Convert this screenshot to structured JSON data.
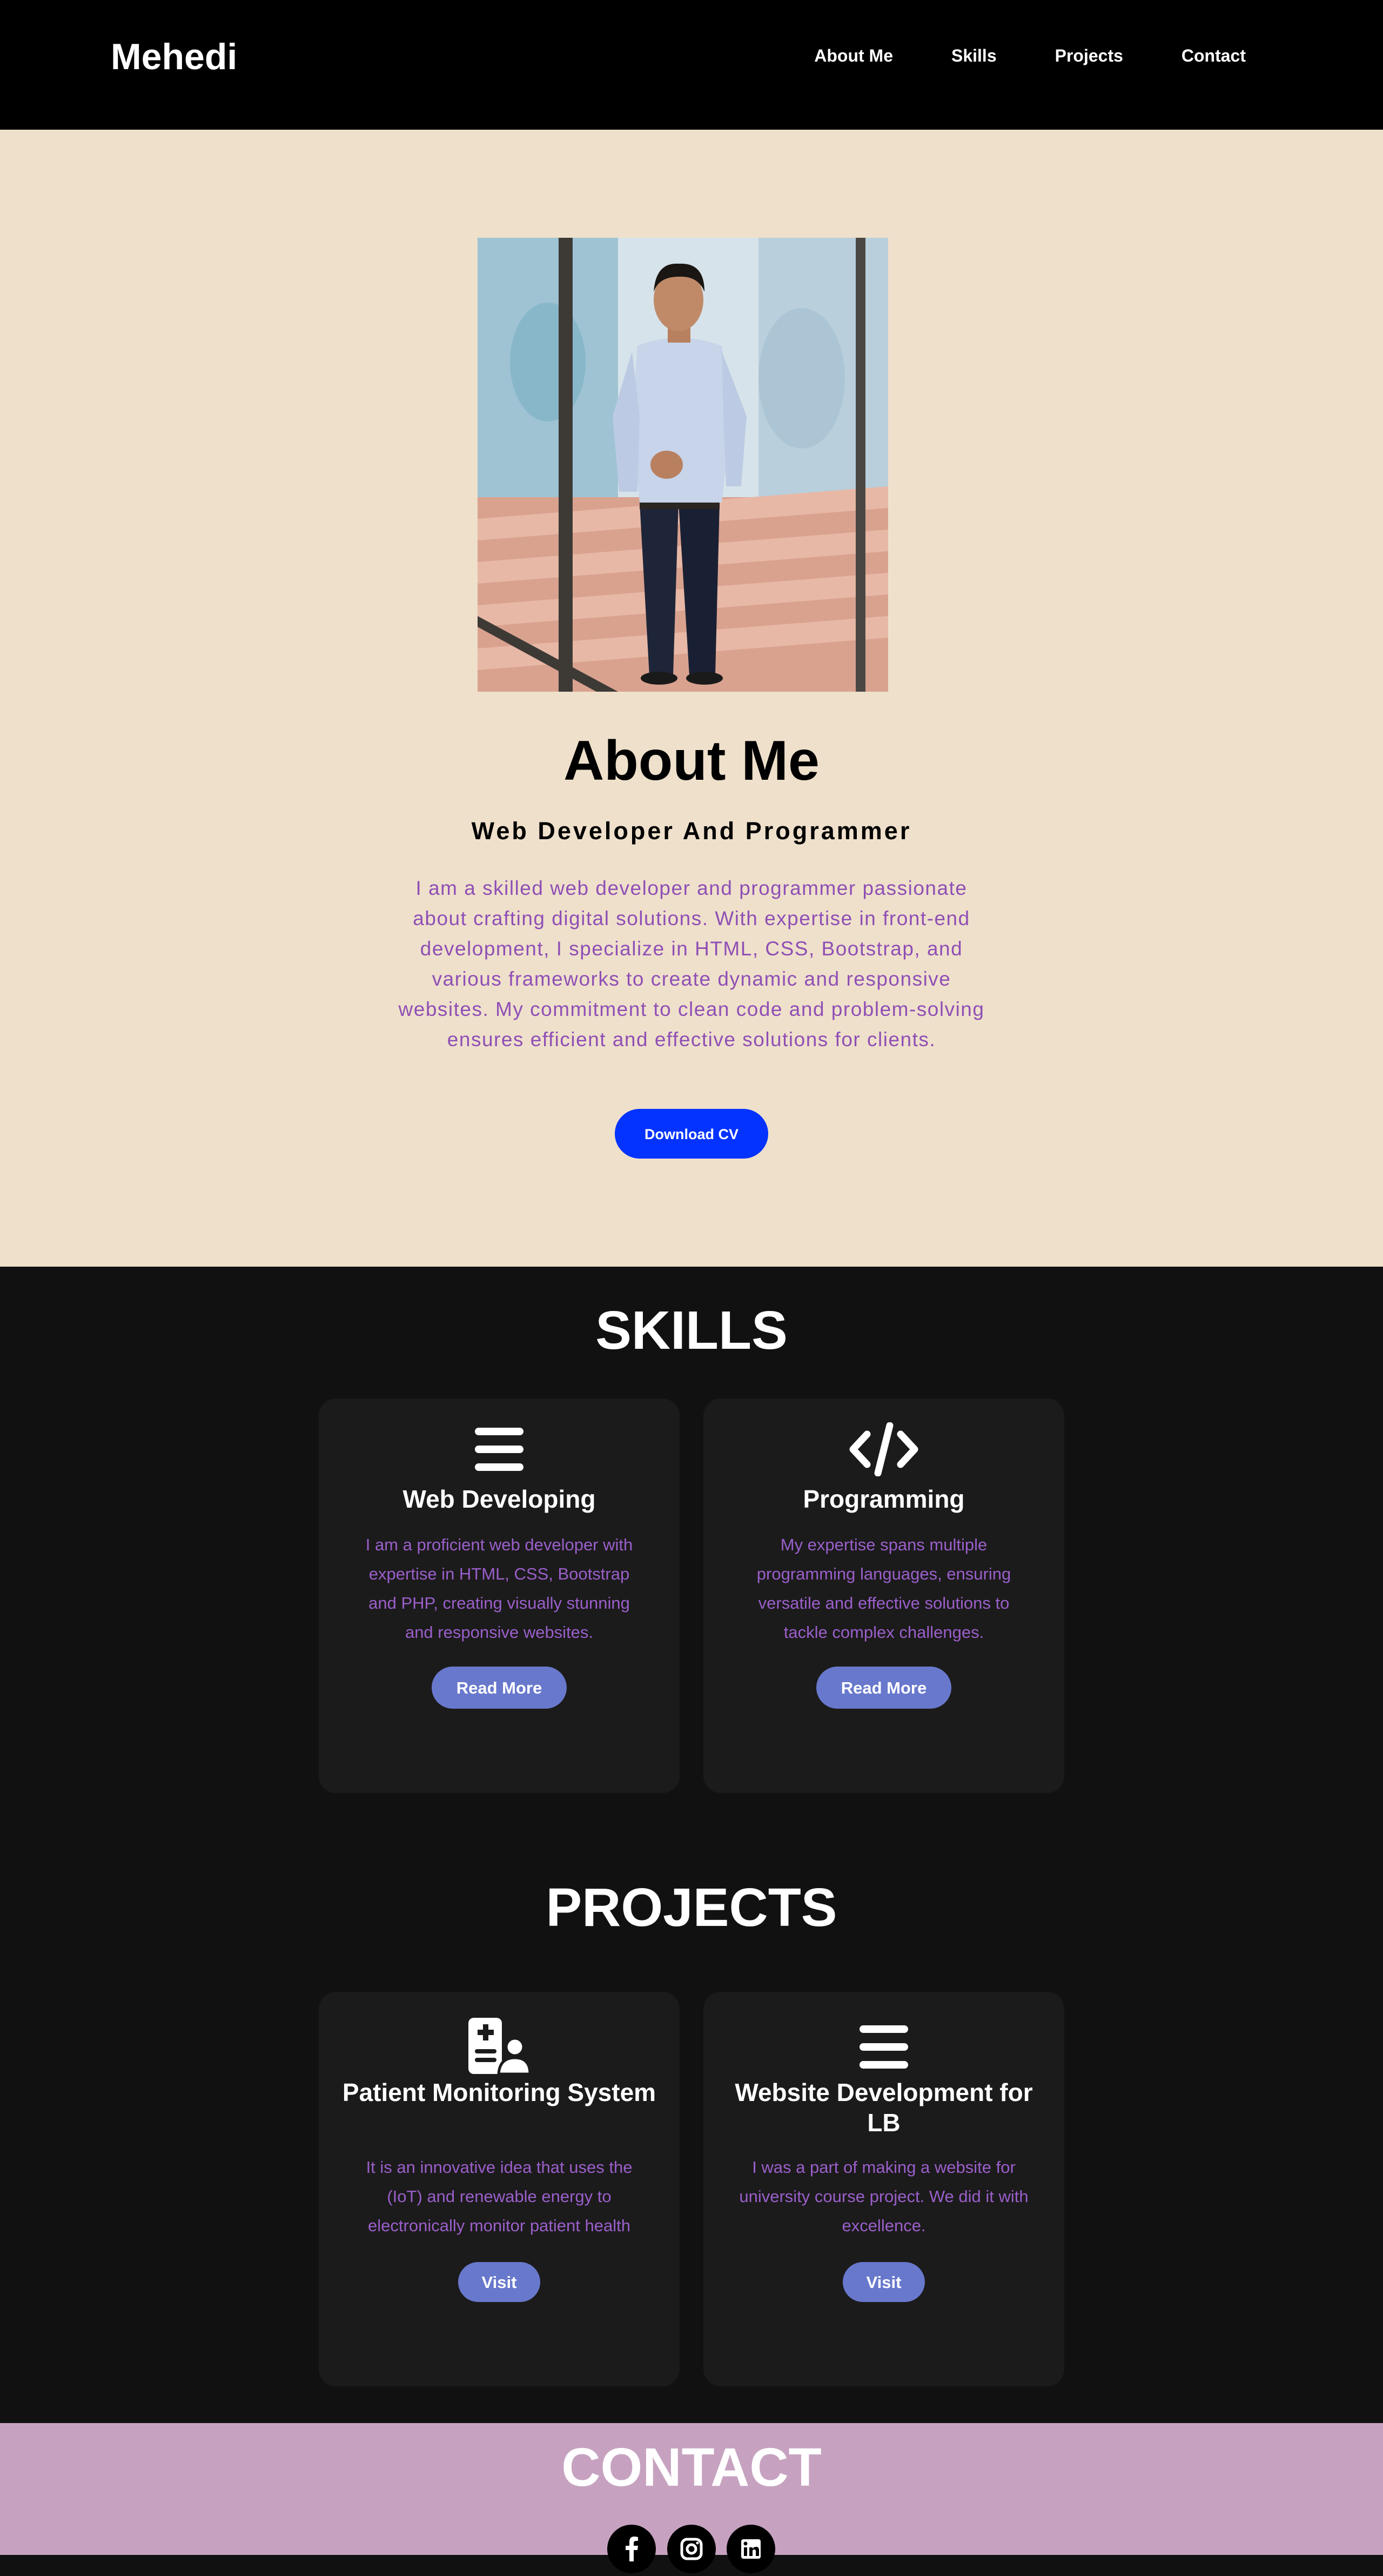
{
  "nav": {
    "brand": "Mehedi",
    "links": [
      "About Me",
      "Skills",
      "Projects",
      "Contact"
    ]
  },
  "about": {
    "title": "About Me",
    "subtitle": "Web Developer And Programmer",
    "description": "I am a skilled web developer and programmer passionate about crafting digital solutions. With expertise in front-end development, I specialize in HTML, CSS, Bootstrap, and various frameworks to create dynamic and responsive websites. My commitment to clean code and problem-solving ensures efficient and effective solutions for clients.",
    "button": "Download CV"
  },
  "skills": {
    "title": "SKILLS",
    "cards": [
      {
        "icon": "hamburger-lines-icon",
        "title": "Web Developing",
        "description": "I am a proficient web developer with expertise in HTML, CSS, Bootstrap and PHP, creating visually stunning and responsive websites.",
        "button": "Read More"
      },
      {
        "icon": "code-icon",
        "title": "Programming",
        "description": "My expertise spans multiple programming languages, ensuring versatile and effective solutions to tackle complex challenges.",
        "button": "Read More"
      }
    ]
  },
  "projects": {
    "title": "PROJECTS",
    "cards": [
      {
        "icon": "patient-medical-icon",
        "title": "Patient Monitoring System",
        "description": "It is an innovative idea that uses the (IoT) and renewable energy to electronically monitor patient health",
        "button": "Visit"
      },
      {
        "icon": "hamburger-lines-icon",
        "title": "Website Development for LB",
        "description": "I was a part of making a website for university course project. We did it with excellence.",
        "button": "Visit"
      }
    ]
  },
  "contact": {
    "title": "CONTACT",
    "socials": [
      "facebook-icon",
      "instagram-icon",
      "linkedin-icon"
    ]
  },
  "colors": {
    "nav_bg": "#000000",
    "about_bg": "#efe0cb",
    "accent_purple": "#9b5fcb",
    "cv_button": "#0433ff",
    "card_button": "#6878cc",
    "contact_bg": "#c6a2c0"
  }
}
